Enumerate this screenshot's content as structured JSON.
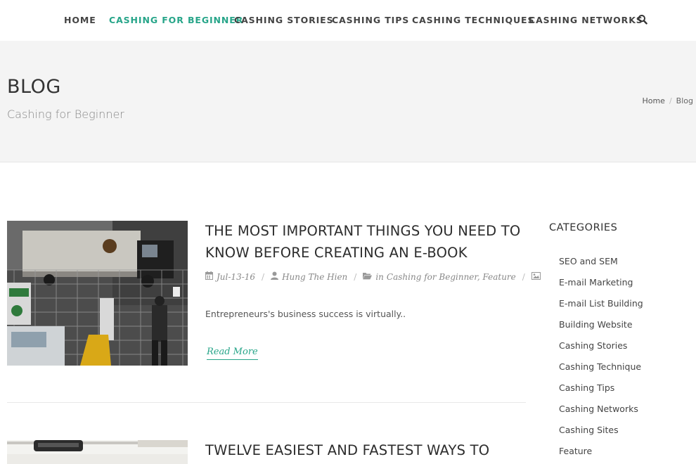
{
  "nav": {
    "items": [
      {
        "label": "HOME",
        "active": false
      },
      {
        "label": "CASHING FOR BEGINNER",
        "active": true
      },
      {
        "label": "CASHING STORIES",
        "active": false
      },
      {
        "label": "CASHING TIPS",
        "active": false
      },
      {
        "label": "CASHING TECHNIQUES",
        "active": false
      },
      {
        "label": "CASHING NETWORKS",
        "active": false
      }
    ],
    "search_icon": "search-icon"
  },
  "header": {
    "title": "BLOG",
    "subtitle": "Cashing for Beginner",
    "breadcrumb": {
      "home": "Home",
      "separator": "/",
      "current": "Blog"
    }
  },
  "posts": [
    {
      "title": "THE MOST IMPORTANT THINGS YOU NEED TO KNOW BEFORE CREATING AN E-BOOK",
      "date": "Jul-13-16",
      "author": "Hung The Hien",
      "categories_prefix": "in",
      "categories": "Cashing for Beginner, Feature",
      "excerpt": "Entrepreneurs's business success is virtually..",
      "read_more": "Read More"
    },
    {
      "title": "TWELVE EASIEST AND FASTEST WAYS TO CREATE"
    }
  ],
  "sidebar": {
    "title": "CATEGORIES",
    "items": [
      "SEO and SEM",
      "E-mail Marketing",
      "E-mail List Building",
      "Building Website",
      "Cashing Stories",
      "Cashing Technique",
      "Cashing Tips",
      "Cashing Networks",
      "Cashing Sites",
      "Feature"
    ]
  },
  "colors": {
    "accent": "#27a589",
    "band": "#f4f4f4",
    "text": "#333333"
  }
}
